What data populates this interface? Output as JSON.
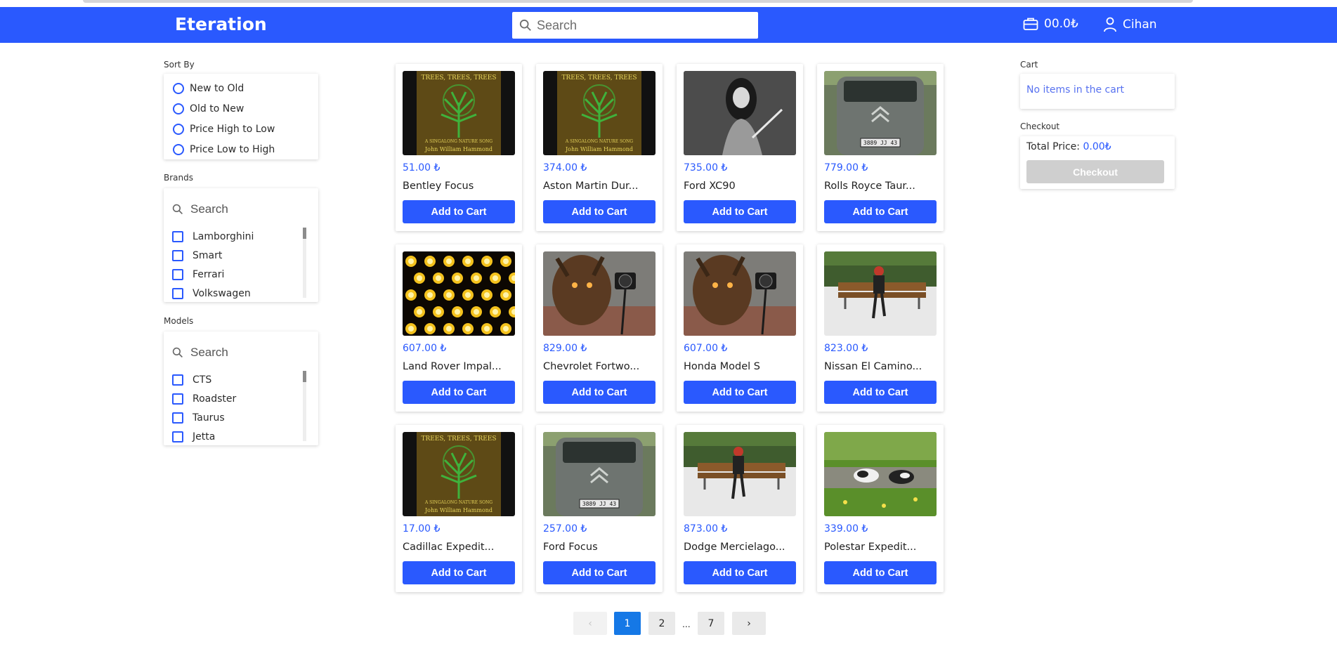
{
  "brand": {
    "name": "Eteration"
  },
  "header": {
    "search_placeholder": "Search",
    "cart_total": "00.0₺",
    "user_name": "Cihan",
    "accent": "#2a59fe"
  },
  "sort": {
    "label": "Sort By",
    "options": [
      "New to Old",
      "Old to New",
      "Price High to Low",
      "Price Low to High"
    ]
  },
  "brands": {
    "label": "Brands",
    "search_placeholder": "Search",
    "items": [
      "Lamborghini",
      "Smart",
      "Ferrari",
      "Volkswagen"
    ]
  },
  "models": {
    "label": "Models",
    "search_placeholder": "Search",
    "items": [
      "CTS",
      "Roadster",
      "Taurus",
      "Jetta"
    ]
  },
  "products": [
    {
      "price": "51.00 ₺",
      "name": "Bentley Focus",
      "image": "trees-album-cover",
      "button": "Add to Cart"
    },
    {
      "price": "374.00 ₺",
      "name": "Aston Martin Dur...",
      "image": "trees-album-cover",
      "button": "Add to Cart"
    },
    {
      "price": "735.00 ₺",
      "name": "Ford XC90",
      "image": "bw-portrait-woman",
      "button": "Add to Cart"
    },
    {
      "price": "779.00 ₺",
      "name": "Rolls Royce Taur...",
      "image": "grey-citroen-van",
      "button": "Add to Cart"
    },
    {
      "price": "607.00 ₺",
      "name": "Land Rover Impal...",
      "image": "yellow-dots-lights",
      "button": "Add to Cart"
    },
    {
      "price": "829.00 ₺",
      "name": "Chevrolet Fortwo...",
      "image": "demon-with-camera",
      "button": "Add to Cart"
    },
    {
      "price": "607.00 ₺",
      "name": "Honda Model S",
      "image": "demon-with-camera",
      "button": "Add to Cart"
    },
    {
      "price": "823.00 ₺",
      "name": "Nissan El Camino...",
      "image": "woman-on-bench",
      "button": "Add to Cart"
    },
    {
      "price": "17.00 ₺",
      "name": "Cadillac Expedit...",
      "image": "trees-album-cover",
      "button": "Add to Cart"
    },
    {
      "price": "257.00 ₺",
      "name": "Ford Focus",
      "image": "grey-citroen-van",
      "button": "Add to Cart"
    },
    {
      "price": "873.00 ₺",
      "name": "Dodge Mercielago...",
      "image": "woman-on-bench",
      "button": "Add to Cart"
    },
    {
      "price": "339.00 ₺",
      "name": "Polestar Expedit...",
      "image": "cows-in-meadow",
      "button": "Add to Cart"
    }
  ],
  "image_texts": {
    "album_title": "TREES, TREES, TREES",
    "album_subtitle": "A SINGALONG NATURE SONG",
    "album_author": "John William Hammond",
    "plate": "3889 JJ 43"
  },
  "pagination": {
    "prev": "‹",
    "pages": [
      "1",
      "2",
      "7"
    ],
    "ellipsis": "...",
    "next": "›",
    "current": "1"
  },
  "cart": {
    "label": "Cart",
    "empty_text": "No items in the cart"
  },
  "checkout": {
    "label": "Checkout",
    "total_label": "Total Price: ",
    "total_value": "0.00₺",
    "button": "Checkout"
  }
}
